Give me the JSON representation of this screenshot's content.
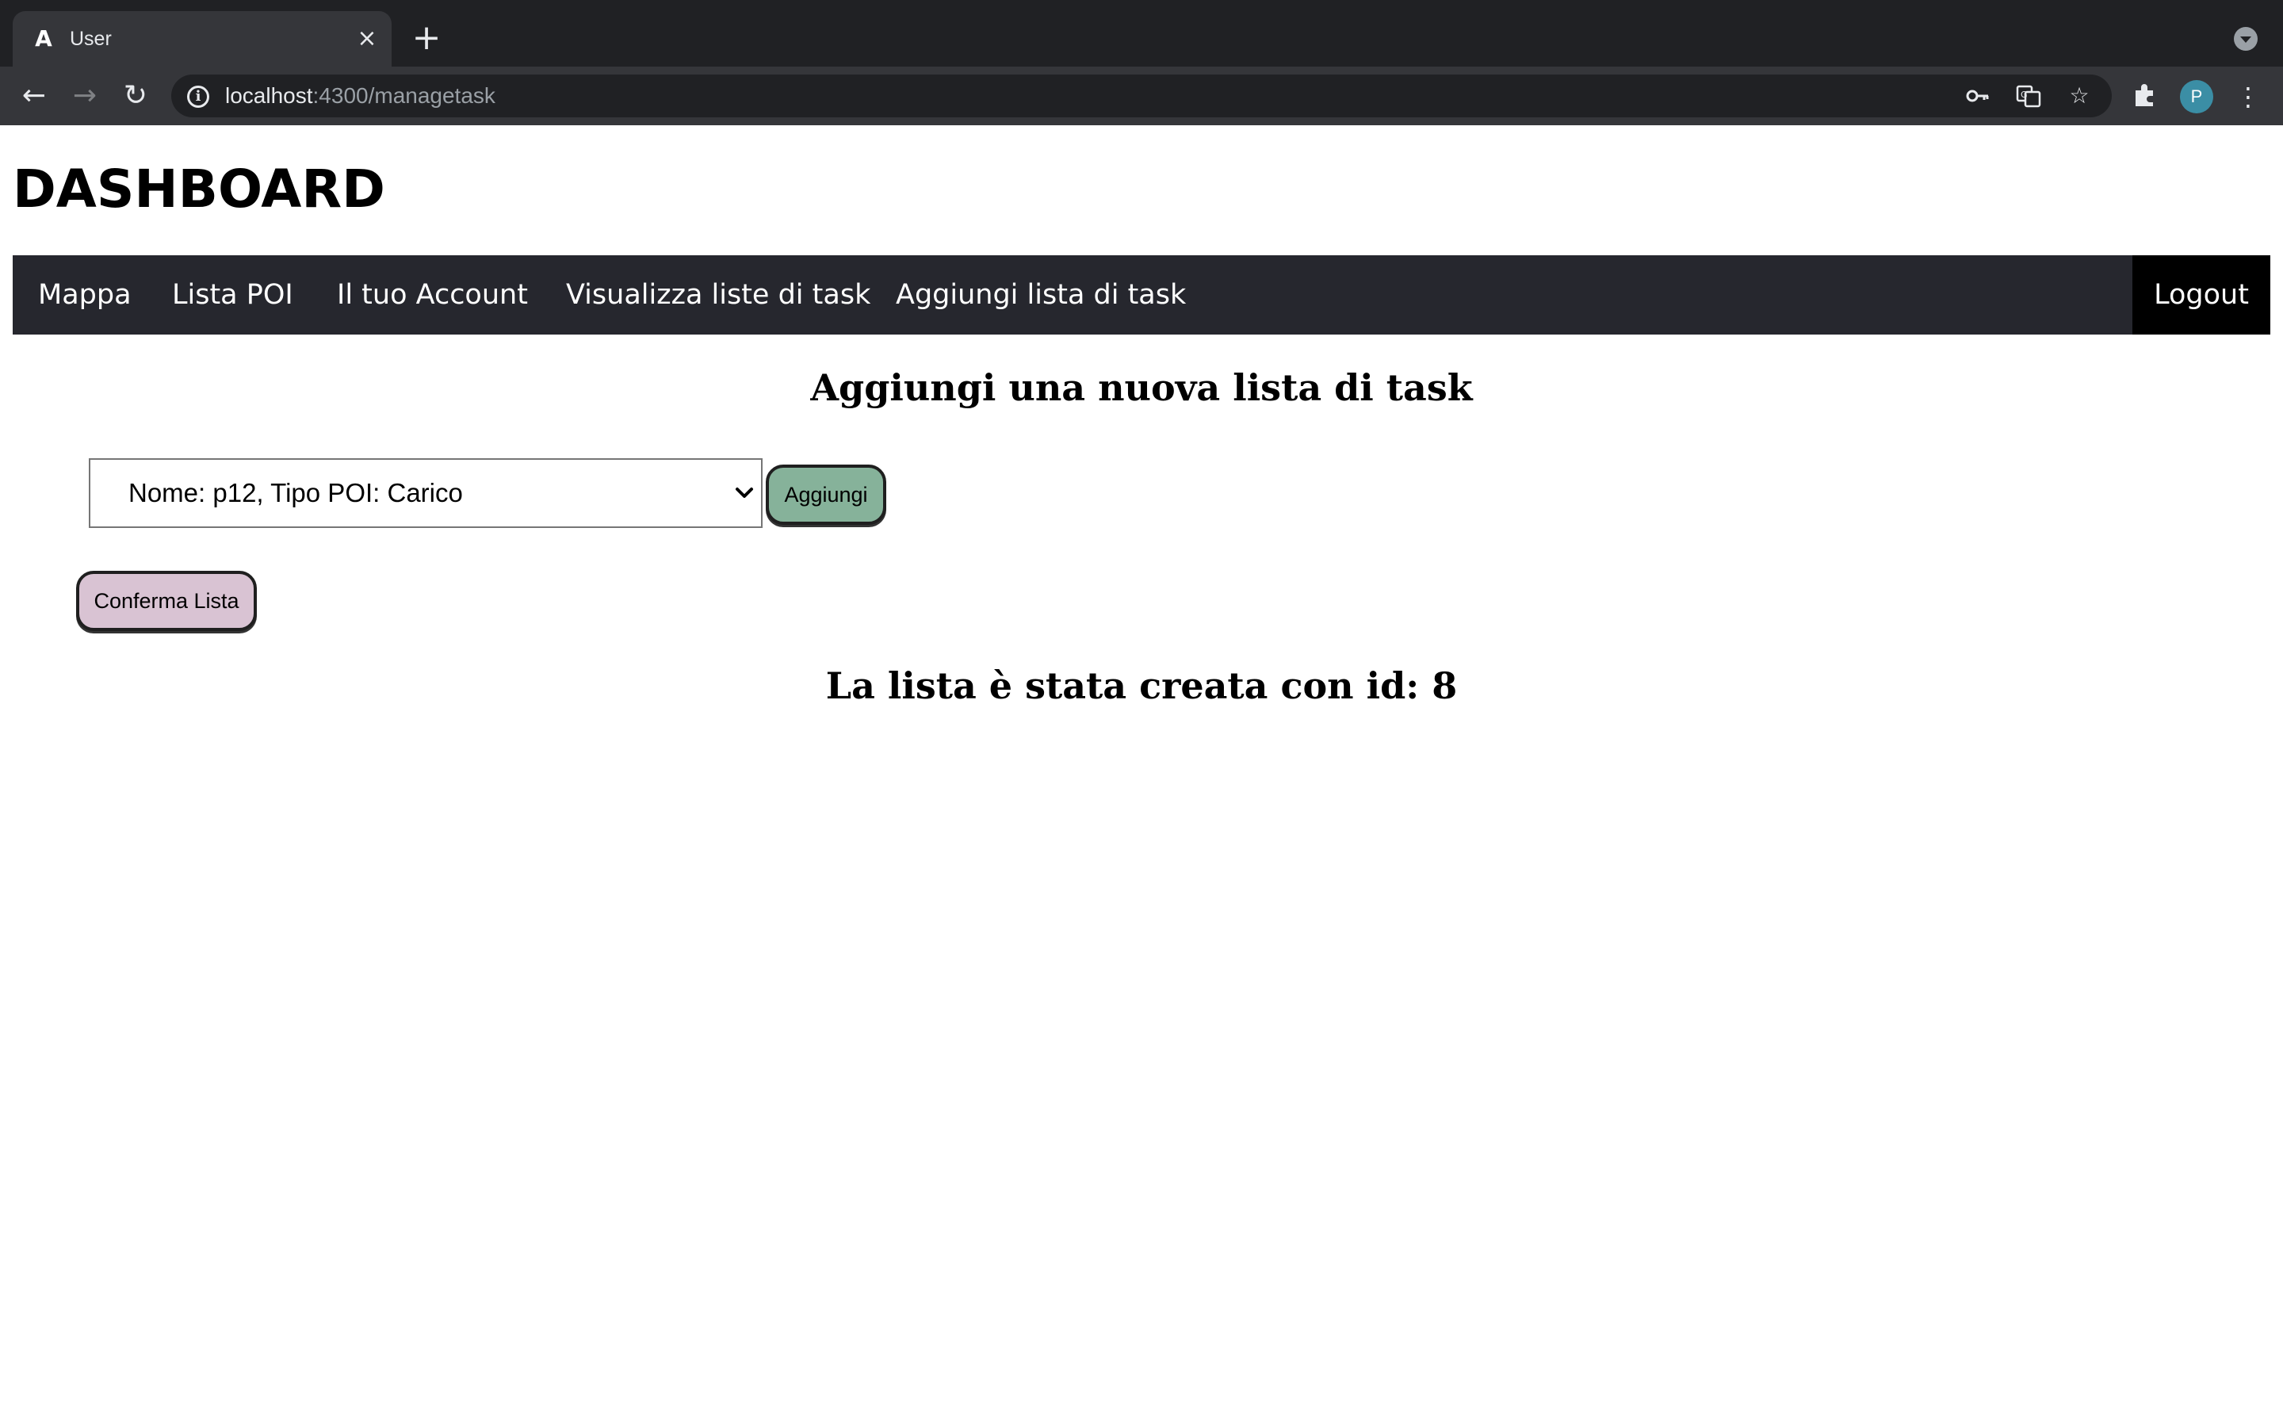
{
  "browser": {
    "tab_title": "User",
    "url_host": "localhost",
    "url_path": ":4300/managetask",
    "profile_initial": "P"
  },
  "page": {
    "title": "DASHBOARD"
  },
  "navbar": {
    "items": [
      {
        "label": "Mappa"
      },
      {
        "label": "Lista POI"
      },
      {
        "label": "Il tuo Account"
      },
      {
        "label": "Visualizza liste di task"
      },
      {
        "label": "Aggiungi lista di task"
      }
    ],
    "logout_label": "Logout"
  },
  "form": {
    "heading": "Aggiungi una nuova lista di task",
    "poi_select_value": "Nome: p12, Tipo POI: Carico",
    "add_button_label": "Aggiungi",
    "confirm_button_label": "Conferma Lista"
  },
  "result": {
    "message": "La lista è stata creata con id: 8"
  },
  "colors": {
    "navbar_bg": "#26272e",
    "logout_bg": "#000000",
    "add_button_bg": "#86b29a",
    "confirm_button_bg": "#d9c3d3"
  }
}
